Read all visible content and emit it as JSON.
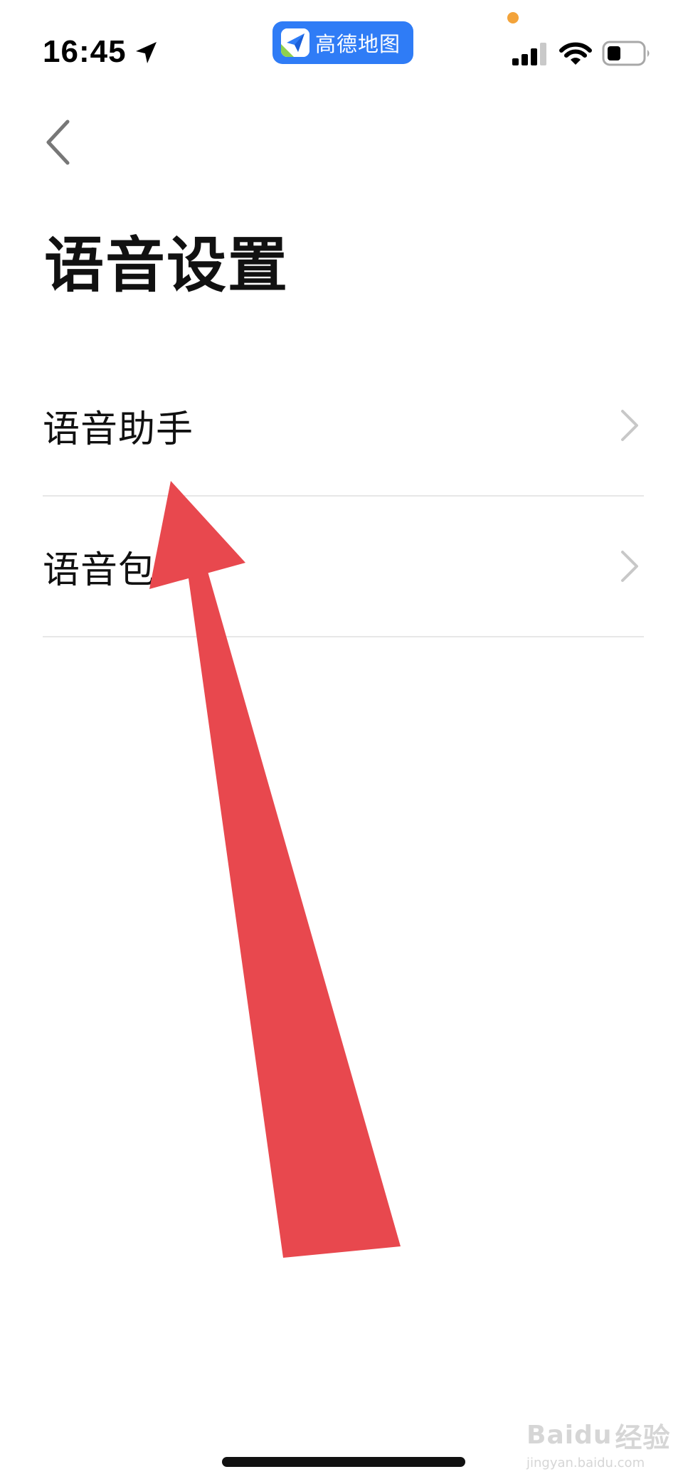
{
  "status_bar": {
    "time": "16:45",
    "app_badge": "高德地图",
    "icons": [
      "location-arrow-icon",
      "cellular-signal-icon",
      "wifi-icon",
      "battery-icon"
    ],
    "privacy_dot_color": "#f3a33a"
  },
  "nav": {
    "back_icon": "chevron-left-icon"
  },
  "page": {
    "title": "语音设置"
  },
  "list": {
    "items": [
      {
        "label": "语音助手",
        "icon": "chevron-right-icon"
      },
      {
        "label": "语音包",
        "icon": "chevron-right-icon"
      }
    ]
  },
  "annotation": {
    "type": "arrow",
    "color": "#e8484e"
  },
  "watermark": {
    "brand": "Bai",
    "brand_suffix": "du",
    "brand_cn": "经验",
    "url": "jingyan.baidu.com"
  },
  "colors": {
    "app_badge_bg": "#2f7cf6",
    "divider": "#e7e7e7",
    "text": "#111111",
    "chevron": "#c8c8c8"
  }
}
